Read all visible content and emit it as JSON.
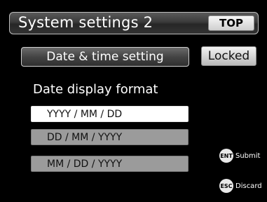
{
  "header": {
    "title": "System settings 2",
    "top_label": "TOP"
  },
  "menu": {
    "date_time_label": "Date & time setting",
    "locked_label": "Locked"
  },
  "date_format": {
    "section_label": "Date display format",
    "selected_index": 0,
    "options": [
      {
        "label": "YYYY / MM / DD"
      },
      {
        "label": "DD / MM / YYYY"
      },
      {
        "label": "MM / DD / YYYY"
      }
    ]
  },
  "keys": {
    "ent": {
      "icon_text": "ENT",
      "label": "Submit"
    },
    "esc": {
      "icon_text": "ESC",
      "label": "Discard"
    }
  },
  "colors": {
    "background": "#000000",
    "selected_option": "#ffffff",
    "unselected_option": "#9b9b9b"
  }
}
